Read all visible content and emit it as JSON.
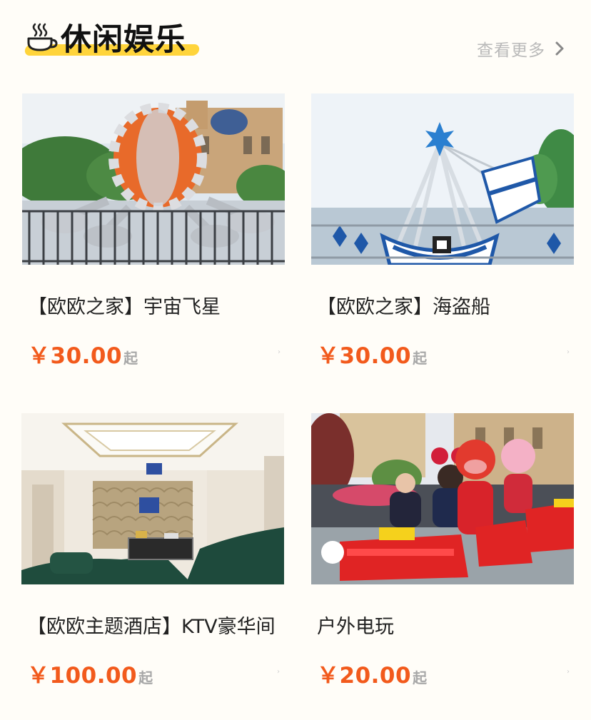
{
  "section": {
    "title": "休闲娱乐",
    "title_icon": "coffee-cup-icon",
    "more_label": "查看更多",
    "more_icon": "chevron-right-icon",
    "accent_color": "#ffd43b",
    "price_color": "#f25a1c"
  },
  "items": [
    {
      "name": "【欧欧之家】宇宙飞星",
      "price": "￥30.00",
      "price_suffix": "起",
      "image": "octopus-ride-photo"
    },
    {
      "name": "【欧欧之家】海盗船",
      "price": "￥30.00",
      "price_suffix": "起",
      "image": "pirate-ship-ride-photo"
    },
    {
      "name": "【欧欧主题酒店】KTV豪华间",
      "price": "￥100.00",
      "price_suffix": "起",
      "image": "ktv-room-photo"
    },
    {
      "name": "户外电玩",
      "price": "￥20.00",
      "price_suffix": "起",
      "image": "outdoor-train-ride-photo"
    }
  ]
}
